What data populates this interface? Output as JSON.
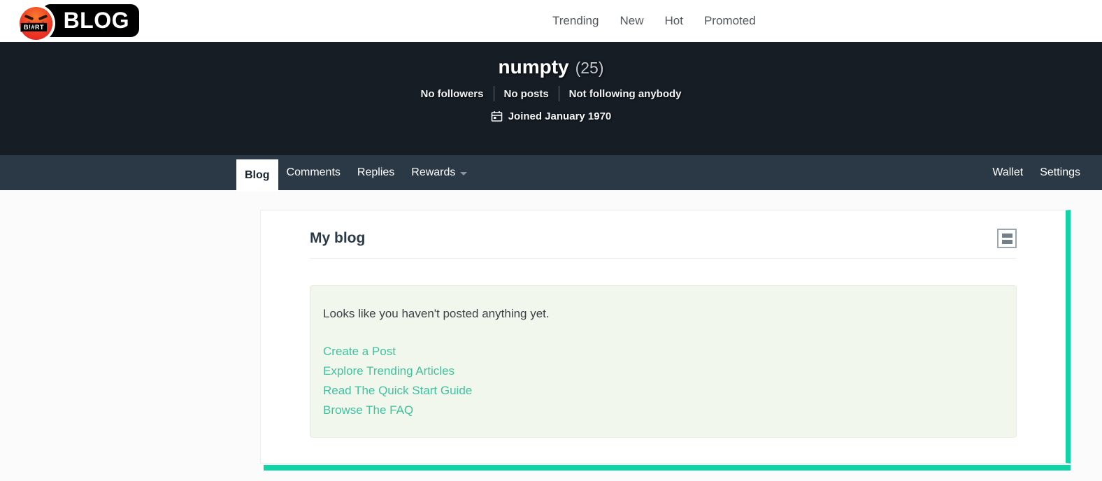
{
  "topbar": {
    "logo": {
      "badge": "B!#RT",
      "text": "BLOG"
    },
    "nav": [
      {
        "label": "Trending"
      },
      {
        "label": "New"
      },
      {
        "label": "Hot"
      },
      {
        "label": "Promoted"
      }
    ]
  },
  "profile": {
    "username": "numpty",
    "reputation": "(25)",
    "stats": [
      "No followers",
      "No posts",
      "Not following anybody"
    ],
    "joined": "Joined January 1970"
  },
  "tabs": {
    "left": [
      {
        "label": "Blog",
        "active": true
      },
      {
        "label": "Comments",
        "active": false
      },
      {
        "label": "Replies",
        "active": false
      },
      {
        "label": "Rewards",
        "active": false,
        "has_dropdown": true
      }
    ],
    "right": [
      {
        "label": "Wallet"
      },
      {
        "label": "Settings"
      }
    ]
  },
  "content": {
    "heading": "My blog",
    "empty_message": "Looks like you haven't posted anything yet.",
    "links": [
      "Create a Post",
      "Explore Trending Articles",
      "Read The Quick Start Guide",
      "Browse The FAQ"
    ]
  },
  "icons": {
    "logo": "angry-emoji-icon",
    "joined": "calendar-icon",
    "rewards": "caret-down-icon",
    "blog_view": "list-view-icon"
  },
  "colors": {
    "accent_green": "#10d4a6",
    "link_teal": "#40c2a0",
    "profile_header_bg": "#161d25",
    "tabbar_bg": "#2b3946",
    "alert_bg": "#f1f7ec",
    "page_bg": "#fbfbfb"
  }
}
